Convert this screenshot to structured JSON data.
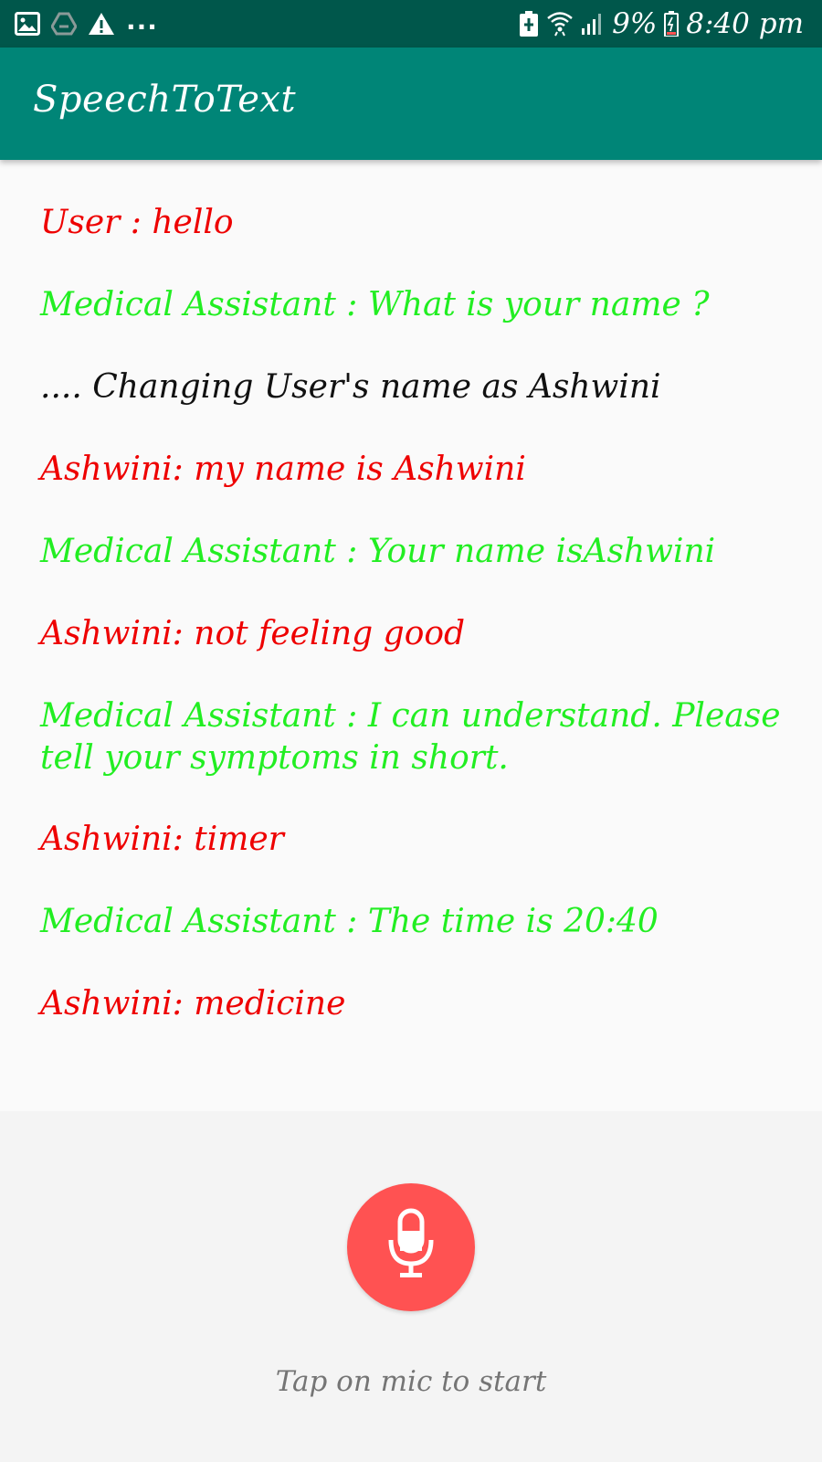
{
  "status_bar": {
    "icons_left": [
      "image-icon",
      "drive-icon",
      "warning-icon"
    ],
    "more_indicator": "...",
    "icons_right": [
      "battery-saver-icon",
      "wifi-icon",
      "signal-icon",
      "battery-icon"
    ],
    "battery_percent": "9%",
    "time": "8:40 pm"
  },
  "app_bar": {
    "title": "SpeechToText"
  },
  "conversation": [
    {
      "role": "user",
      "text": "User : hello"
    },
    {
      "role": "assistant",
      "text": "Medical Assistant : What is your name ?"
    },
    {
      "role": "system",
      "text": ".... Changing User's name as Ashwini"
    },
    {
      "role": "user",
      "text": "Ashwini: my name is Ashwini"
    },
    {
      "role": "assistant",
      "text": "Medical Assistant : Your name isAshwini"
    },
    {
      "role": "user",
      "text": "Ashwini: not feeling good"
    },
    {
      "role": "assistant",
      "text": "Medical Assistant : I can understand. Please tell your symptoms in short."
    },
    {
      "role": "user",
      "text": "Ashwini: timer"
    },
    {
      "role": "assistant",
      "text": "Medical Assistant : The time is 20:40"
    },
    {
      "role": "user",
      "text": "Ashwini: medicine"
    }
  ],
  "mic": {
    "icon": "microphone-icon",
    "color": "#ff5252",
    "hint": "Tap on mic to start"
  },
  "colors": {
    "status_bar": "#00574b",
    "app_bar": "#008577",
    "user_text": "#ee0000",
    "assistant_text": "#22ee22",
    "system_text": "#111111"
  }
}
